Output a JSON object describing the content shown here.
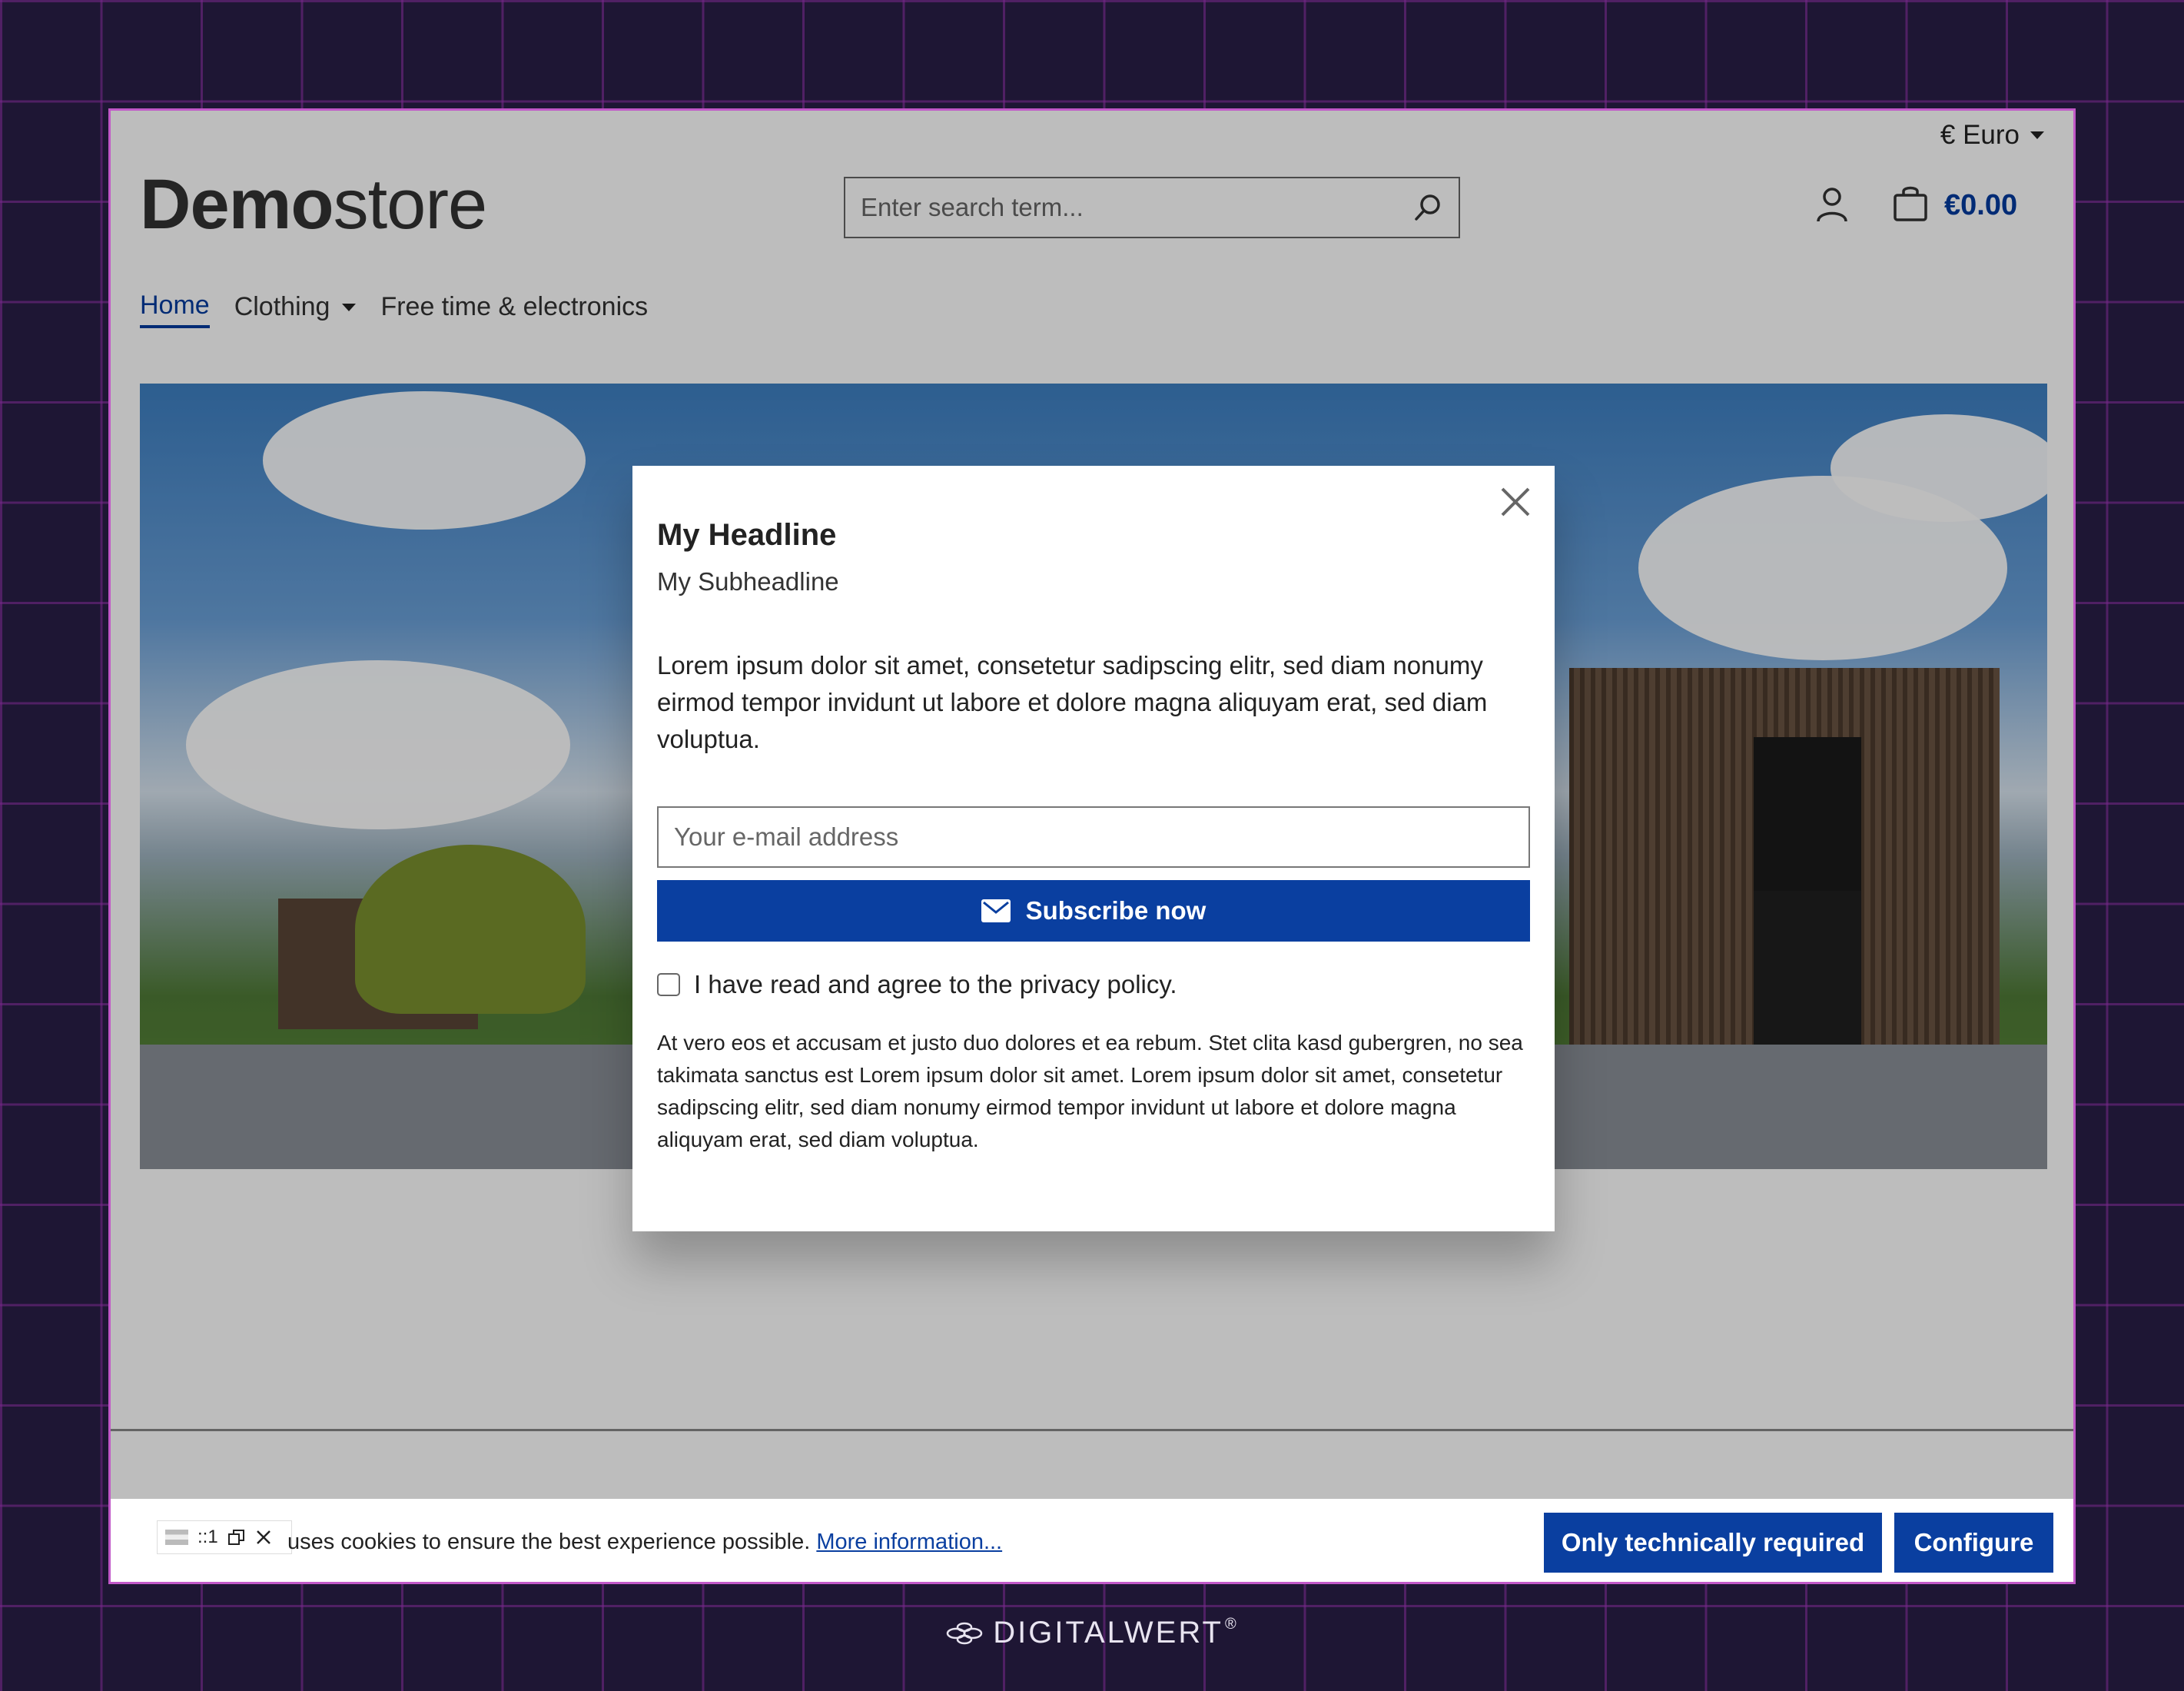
{
  "header": {
    "currency_label": "€ Euro",
    "logo_bold": "Demo",
    "logo_light": "store",
    "search_placeholder": "Enter search term...",
    "cart_amount": "€0.00"
  },
  "nav": {
    "items": [
      {
        "label": "Home",
        "active": true
      },
      {
        "label": "Clothing",
        "dropdown": true
      },
      {
        "label": "Free time & electronics"
      }
    ]
  },
  "modal": {
    "headline": "My Headline",
    "subheadline": "My Subheadline",
    "lead": "Lorem ipsum dolor sit amet, consetetur sadipscing elitr, sed diam nonumy eirmod tempor invidunt ut labore et dolore magna aliquyam erat, sed diam voluptua.",
    "email_placeholder": "Your e-mail address",
    "subscribe_label": "Subscribe now",
    "agree_label": "I have read and agree to the privacy policy.",
    "fine_print": "At vero eos et accusam et justo duo dolores et ea rebum. Stet clita kasd gubergren, no sea takimata sanctus est Lorem ipsum dolor sit amet. Lorem ipsum dolor sit amet, consetetur sadipscing elitr, sed diam nonumy eirmod tempor invidunt ut labore et dolore magna aliquyam erat, sed diam voluptua."
  },
  "cookie": {
    "text": "uses cookies to ensure the best experience possible.",
    "link": "More information...",
    "btn_required": "Only technically required",
    "btn_configure": "Configure",
    "ext_label": "::1"
  },
  "brand": {
    "name": "DIGITALWERT",
    "mark": "®"
  },
  "colors": {
    "accent": "#0a3fa0",
    "background": "#1e1634",
    "frame": "#c158c8"
  }
}
